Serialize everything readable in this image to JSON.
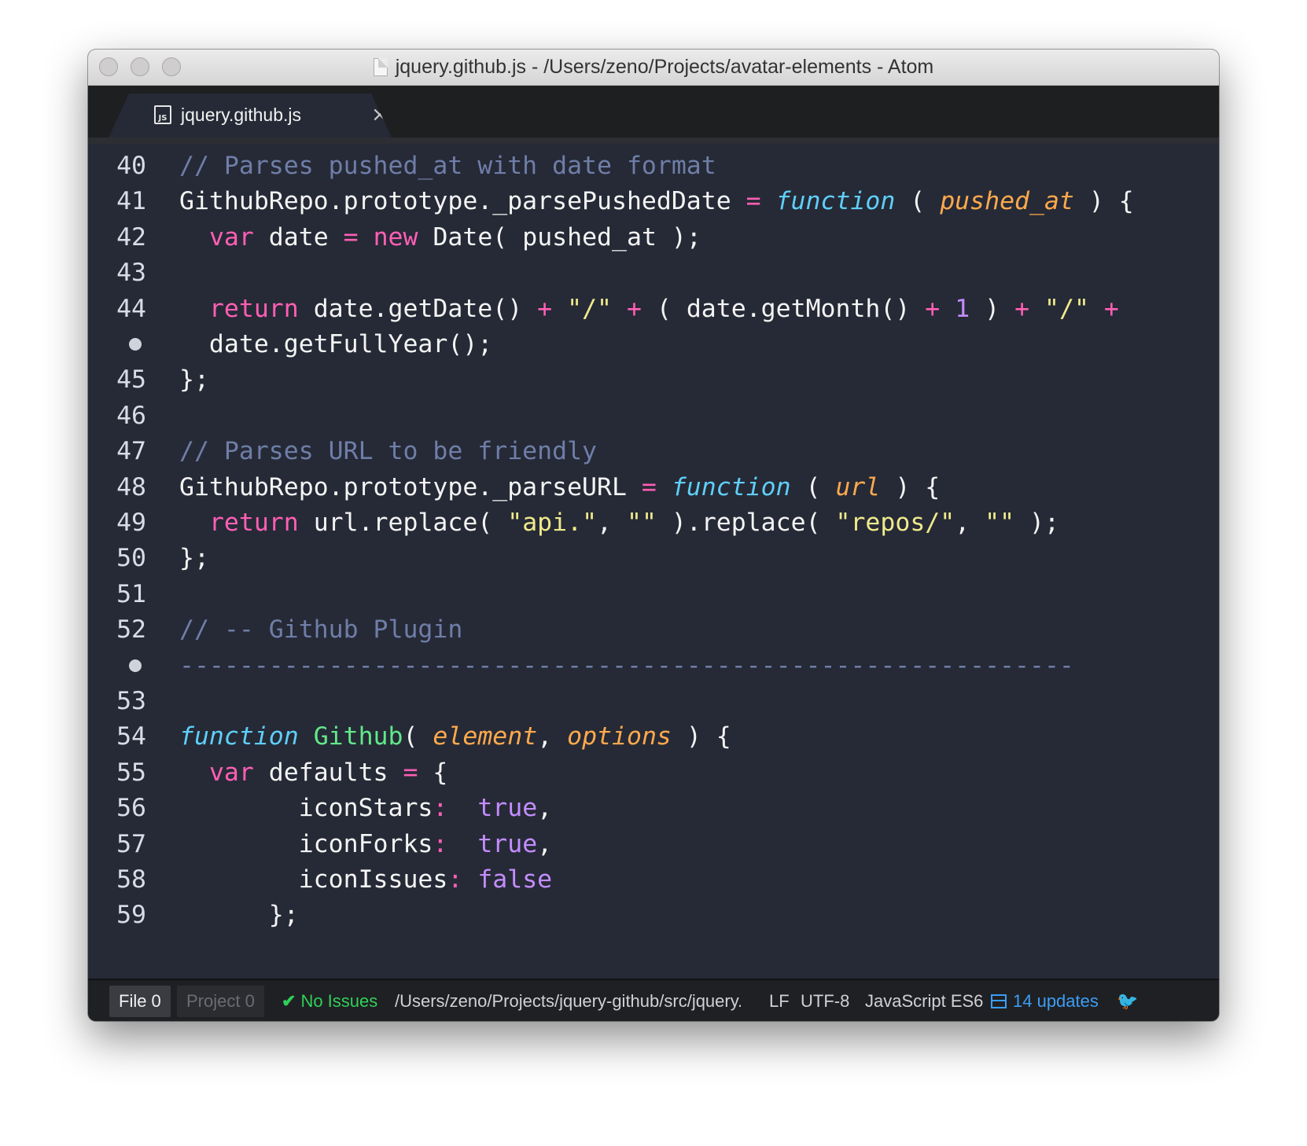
{
  "window": {
    "title": "jquery.github.js - /Users/zeno/Projects/avatar-elements - Atom"
  },
  "tab": {
    "icon": "js-file-icon",
    "icon_text": "JS",
    "label": "jquery.github.js",
    "close_glyph": "×"
  },
  "editor": {
    "lines": [
      {
        "gutter": "40",
        "wrap": false,
        "tokens": [
          {
            "t": "// Parses pushed_at with date format",
            "c": "com"
          }
        ]
      },
      {
        "gutter": "41",
        "wrap": false,
        "tokens": [
          {
            "t": "GithubRepo.prototype._parsePushedDate ",
            "c": ""
          },
          {
            "t": "=",
            "c": "op"
          },
          {
            "t": " ",
            "c": ""
          },
          {
            "t": "function",
            "c": "fn"
          },
          {
            "t": " ( ",
            "c": ""
          },
          {
            "t": "pushed_at",
            "c": "par"
          },
          {
            "t": " ) {",
            "c": ""
          }
        ]
      },
      {
        "gutter": "42",
        "wrap": false,
        "tokens": [
          {
            "t": "  ",
            "c": ""
          },
          {
            "t": "var",
            "c": "kw"
          },
          {
            "t": " date ",
            "c": ""
          },
          {
            "t": "=",
            "c": "op"
          },
          {
            "t": " ",
            "c": ""
          },
          {
            "t": "new",
            "c": "kw"
          },
          {
            "t": " Date( pushed_at );",
            "c": ""
          }
        ]
      },
      {
        "gutter": "43",
        "wrap": false,
        "tokens": []
      },
      {
        "gutter": "44",
        "wrap": false,
        "tokens": [
          {
            "t": "  ",
            "c": ""
          },
          {
            "t": "return",
            "c": "kw"
          },
          {
            "t": " date.getDate() ",
            "c": ""
          },
          {
            "t": "+",
            "c": "op"
          },
          {
            "t": " ",
            "c": ""
          },
          {
            "t": "\"/\"",
            "c": "str"
          },
          {
            "t": " ",
            "c": ""
          },
          {
            "t": "+",
            "c": "op"
          },
          {
            "t": " ( date.getMonth() ",
            "c": ""
          },
          {
            "t": "+",
            "c": "op"
          },
          {
            "t": " ",
            "c": ""
          },
          {
            "t": "1",
            "c": "num"
          },
          {
            "t": " ) ",
            "c": ""
          },
          {
            "t": "+",
            "c": "op"
          },
          {
            "t": " ",
            "c": ""
          },
          {
            "t": "\"/\"",
            "c": "str"
          },
          {
            "t": " ",
            "c": ""
          },
          {
            "t": "+",
            "c": "op"
          }
        ]
      },
      {
        "gutter": "",
        "wrap": true,
        "tokens": [
          {
            "t": "  date.getFullYear();",
            "c": ""
          }
        ]
      },
      {
        "gutter": "45",
        "wrap": false,
        "tokens": [
          {
            "t": "};",
            "c": ""
          }
        ]
      },
      {
        "gutter": "46",
        "wrap": false,
        "tokens": []
      },
      {
        "gutter": "47",
        "wrap": false,
        "tokens": [
          {
            "t": "// Parses URL to be friendly",
            "c": "com"
          }
        ]
      },
      {
        "gutter": "48",
        "wrap": false,
        "tokens": [
          {
            "t": "GithubRepo.prototype._parseURL ",
            "c": ""
          },
          {
            "t": "=",
            "c": "op"
          },
          {
            "t": " ",
            "c": ""
          },
          {
            "t": "function",
            "c": "fn"
          },
          {
            "t": " ( ",
            "c": ""
          },
          {
            "t": "url",
            "c": "par"
          },
          {
            "t": " ) {",
            "c": ""
          }
        ]
      },
      {
        "gutter": "49",
        "wrap": false,
        "tokens": [
          {
            "t": "  ",
            "c": ""
          },
          {
            "t": "return",
            "c": "kw"
          },
          {
            "t": " url.replace( ",
            "c": ""
          },
          {
            "t": "\"api.\"",
            "c": "str"
          },
          {
            "t": ", ",
            "c": ""
          },
          {
            "t": "\"\"",
            "c": "str"
          },
          {
            "t": " ).replace( ",
            "c": ""
          },
          {
            "t": "\"repos/\"",
            "c": "str"
          },
          {
            "t": ", ",
            "c": ""
          },
          {
            "t": "\"\"",
            "c": "str"
          },
          {
            "t": " );",
            "c": ""
          }
        ]
      },
      {
        "gutter": "50",
        "wrap": false,
        "tokens": [
          {
            "t": "};",
            "c": ""
          }
        ]
      },
      {
        "gutter": "51",
        "wrap": false,
        "tokens": []
      },
      {
        "gutter": "52",
        "wrap": false,
        "tokens": [
          {
            "t": "// -- Github Plugin",
            "c": "com"
          }
        ]
      },
      {
        "gutter": "",
        "wrap": true,
        "tokens": [
          {
            "t": "------------------------------------------------------------",
            "c": "com"
          }
        ]
      },
      {
        "gutter": "53",
        "wrap": false,
        "tokens": []
      },
      {
        "gutter": "54",
        "wrap": false,
        "tokens": [
          {
            "t": "function",
            "c": "fn"
          },
          {
            "t": " ",
            "c": ""
          },
          {
            "t": "Github",
            "c": "name"
          },
          {
            "t": "( ",
            "c": ""
          },
          {
            "t": "element",
            "c": "par"
          },
          {
            "t": ", ",
            "c": ""
          },
          {
            "t": "options",
            "c": "par"
          },
          {
            "t": " ) {",
            "c": ""
          }
        ]
      },
      {
        "gutter": "55",
        "wrap": false,
        "tokens": [
          {
            "t": "  ",
            "c": ""
          },
          {
            "t": "var",
            "c": "kw"
          },
          {
            "t": " defaults ",
            "c": ""
          },
          {
            "t": "=",
            "c": "op"
          },
          {
            "t": " {",
            "c": ""
          }
        ]
      },
      {
        "gutter": "56",
        "wrap": false,
        "tokens": [
          {
            "t": "        iconStars",
            "c": ""
          },
          {
            "t": ":",
            "c": "op"
          },
          {
            "t": "  ",
            "c": ""
          },
          {
            "t": "true",
            "c": "num"
          },
          {
            "t": ",",
            "c": ""
          }
        ]
      },
      {
        "gutter": "57",
        "wrap": false,
        "tokens": [
          {
            "t": "        iconForks",
            "c": ""
          },
          {
            "t": ":",
            "c": "op"
          },
          {
            "t": "  ",
            "c": ""
          },
          {
            "t": "true",
            "c": "num"
          },
          {
            "t": ",",
            "c": ""
          }
        ]
      },
      {
        "gutter": "58",
        "wrap": false,
        "tokens": [
          {
            "t": "        iconIssues",
            "c": ""
          },
          {
            "t": ":",
            "c": "op"
          },
          {
            "t": " ",
            "c": ""
          },
          {
            "t": "false",
            "c": "num"
          }
        ]
      },
      {
        "gutter": "59",
        "wrap": false,
        "tokens": [
          {
            "t": "      };",
            "c": ""
          }
        ]
      }
    ]
  },
  "statusbar": {
    "file_label": "File 0",
    "project_label": "Project 0",
    "issues_icon": "check-icon",
    "issues_check": "✔",
    "issues_label": "No Issues",
    "path": "/Users/zeno/Projects/jquery-github/src/jquery.github.js",
    "line_ending": "LF",
    "encoding": "UTF-8",
    "grammar": "JavaScript ES6",
    "updates_icon": "package-icon",
    "updates_label": "14 updates",
    "bird_icon": "squirrel-icon",
    "bird_glyph": "🐦"
  },
  "colors": {
    "editor_bg": "#262a36",
    "comment": "#6f7ea8",
    "keyword": "#ff5fb5",
    "function": "#5ecffa",
    "parameter": "#ffa94d",
    "string": "#f0ea8c",
    "number": "#c38dff",
    "name": "#62e88a",
    "status_ok": "#2fd05a",
    "status_link": "#3c9df5"
  }
}
